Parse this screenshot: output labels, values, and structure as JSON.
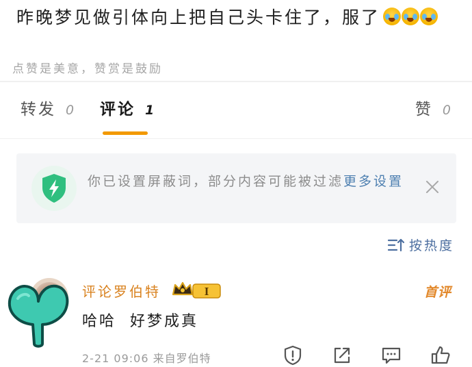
{
  "post": {
    "text": "昨晚梦见做引体向上把自己头卡住了，服了",
    "emojis": [
      "laugh-cry-emoji",
      "laugh-cry-emoji",
      "laugh-cry-emoji"
    ]
  },
  "reward_slogan": "点赞是美意，赞赏是鼓励",
  "tabs": {
    "repost_label": "转发",
    "repost_count": "0",
    "comment_label": "评论",
    "comment_count": "1",
    "like_label": "赞",
    "like_count": "0"
  },
  "filter_notice": {
    "text": "你已设置屏蔽词，部分内容可能被过滤",
    "link": "更多设置",
    "icon": "shield-lightning-icon"
  },
  "sort": {
    "label": "按热度",
    "icon": "sort-icon"
  },
  "comments": [
    {
      "username": "评论罗伯特",
      "badge_level": "I",
      "first_comment_label": "首评",
      "text": "哈哈  好梦成真",
      "time": "2-21 09:06",
      "source": "来自罗伯特"
    }
  ],
  "colors": {
    "accent_orange": "#f29900",
    "link_blue": "#4d7fb0",
    "username_orange": "#d9821f",
    "shield_green": "#2fbf7f"
  }
}
